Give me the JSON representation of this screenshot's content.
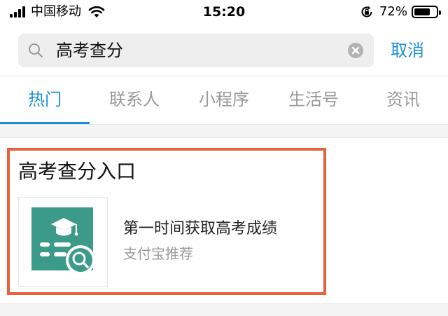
{
  "status_bar": {
    "carrier": "中国移动",
    "time": "15:20",
    "battery_percent": "72%",
    "battery_level": 0.72
  },
  "search": {
    "query": "高考查分",
    "cancel_label": "取消",
    "accent_color": "#1a8fd6"
  },
  "tabs": [
    {
      "label": "热门",
      "active": true
    },
    {
      "label": "联系人",
      "active": false
    },
    {
      "label": "小程序",
      "active": false
    },
    {
      "label": "生活号",
      "active": false
    },
    {
      "label": "资讯",
      "active": false
    }
  ],
  "result": {
    "title": "高考查分入口",
    "highlight_color": "#e8613c",
    "item": {
      "name": "第一时间获取高考成绩",
      "source": "支付宝推荐",
      "icon": "graduation-search-icon",
      "icon_color": "#3c9a89"
    }
  }
}
